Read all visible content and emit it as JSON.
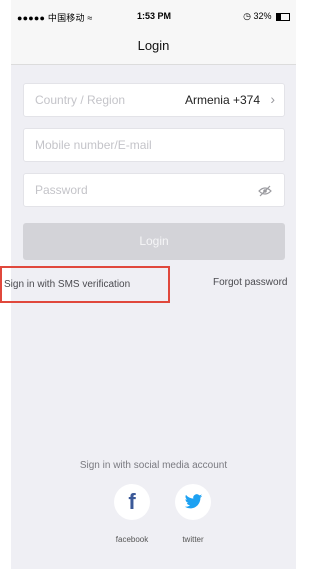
{
  "status_bar": {
    "carrier": "●●●●● 中国移动",
    "wifi_icon": "wifi-icon",
    "time": "1:53 PM",
    "battery_text": "32%",
    "battery_level": 0.32
  },
  "navbar": {
    "title": "Login"
  },
  "form": {
    "country_label": "Country / Region",
    "country_value": "Armenia +374",
    "mobile_placeholder": "Mobile number/E-mail",
    "password_placeholder": "Password",
    "login_label": "Login"
  },
  "links": {
    "sms": "Sign in with SMS verification",
    "forgot": "Forgot password"
  },
  "social": {
    "caption": "Sign in with social media account",
    "facebook_label": "facebook",
    "twitter_label": "twitter"
  },
  "colors": {
    "screen_bg": "#efeff4",
    "highlight_border": "#e0483c",
    "facebook_blue": "#3b5998",
    "twitter_blue": "#1da1f2"
  }
}
